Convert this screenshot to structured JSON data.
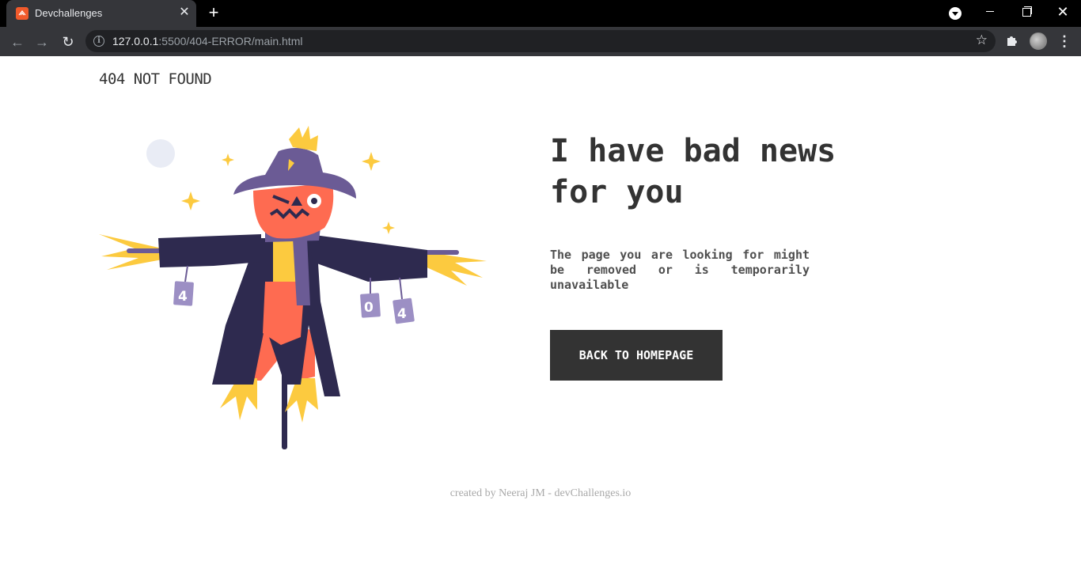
{
  "browser": {
    "tab": {
      "title": "Devchallenges",
      "close_glyph": "✕",
      "favicon": "devchallenges-logo-icon"
    },
    "new_tab_glyph": "+",
    "window_controls": {
      "close_glyph": "✕"
    },
    "toolbar": {
      "back_glyph": "←",
      "forward_glyph": "→",
      "reload_glyph": "↻",
      "url_host": "127.0.0.1",
      "url_path": ":5500/404-ERROR/main.html",
      "info_glyph": "i",
      "star_glyph": "☆",
      "menu_glyph": "⋮"
    }
  },
  "page": {
    "logo": "404 NOT FOUND",
    "headline": "I have bad news for you",
    "description": "The page you are looking for might be removed or is temporarily unavailable",
    "cta_label": "BACK TO HOMEPAGE",
    "footer": "created by Neeraj JM - devChallenges.io",
    "illustration": {
      "icon": "scarecrow-illustration",
      "sign_letters": [
        "4",
        "0",
        "4"
      ]
    }
  },
  "colors": {
    "text_dark": "#333333",
    "text_body": "#4f4f4f",
    "button_bg": "#333333",
    "footer_text": "#a9a9a9",
    "scarecrow_orange": "#fe6b51",
    "scarecrow_purple": "#6b5b95",
    "scarecrow_navy": "#2e2a4f",
    "straw_yellow": "#fcca3f"
  }
}
